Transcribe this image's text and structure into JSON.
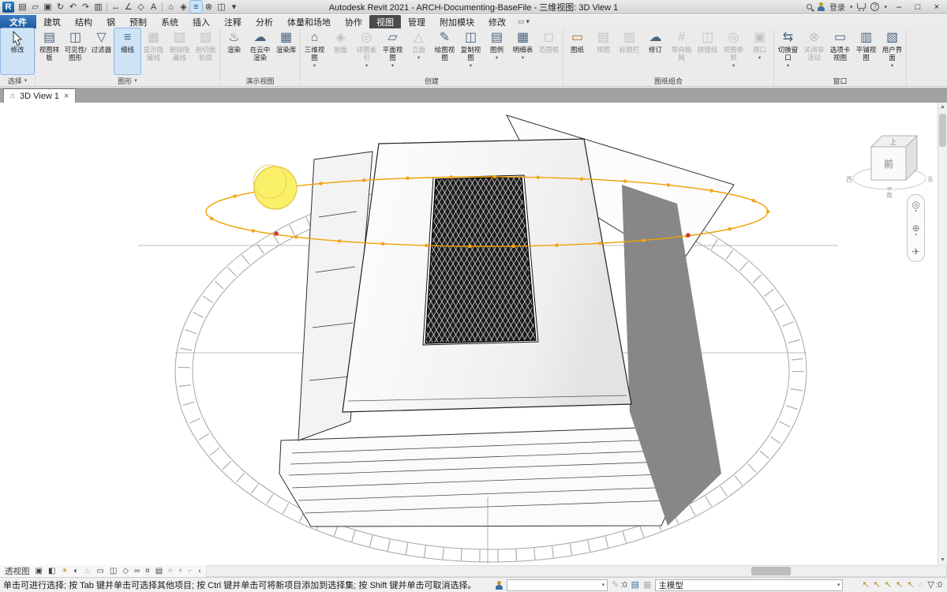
{
  "titlebar": {
    "title": "Autodesk Revit 2021 - ARCH-Documenting-BaseFile - 三维视图: 3D View 1",
    "qat": [
      {
        "name": "revit-logo",
        "glyph": "R"
      },
      {
        "name": "active-document-icon",
        "glyph": "▤"
      },
      {
        "name": "open-icon",
        "glyph": "▱"
      },
      {
        "name": "save-icon",
        "glyph": "▣"
      },
      {
        "name": "sync-with-central-icon",
        "glyph": "↻"
      },
      {
        "name": "undo-icon",
        "glyph": "↶"
      },
      {
        "name": "redo-icon",
        "glyph": "↷"
      },
      {
        "name": "print-icon",
        "glyph": "▥"
      },
      {
        "name": "measure-icon",
        "glyph": "↔"
      },
      {
        "name": "aligned-dimension-icon",
        "glyph": "∠"
      },
      {
        "name": "tag-by-category-icon",
        "glyph": "◇"
      },
      {
        "name": "text-icon",
        "glyph": "A"
      },
      {
        "name": "default-3d-view-icon",
        "glyph": "⌂"
      },
      {
        "name": "section-icon",
        "glyph": "◈"
      },
      {
        "name": "thin-lines-icon",
        "glyph": "≡"
      },
      {
        "name": "close-hidden-windows-icon",
        "glyph": "⊗"
      },
      {
        "name": "switch-windows-icon",
        "glyph": "◫"
      },
      {
        "name": "customize-qat-icon",
        "glyph": "▾"
      }
    ],
    "signin_label": "登录",
    "window": {
      "min": "–",
      "max": "□",
      "close": "×"
    }
  },
  "ui": {
    "caret": "▾",
    "tab_close": "×",
    "house": "⌂",
    "scroll_up": "▲",
    "scroll_down": "▼",
    "collapse": "‹"
  },
  "ribbon": {
    "file_tab": "文件",
    "tabs": [
      "建筑",
      "结构",
      "钢",
      "预制",
      "系统",
      "插入",
      "注释",
      "分析",
      "体量和场地",
      "协作",
      "视图",
      "管理",
      "附加模块",
      "修改"
    ],
    "options_glyph": "▭",
    "panels": [
      {
        "label": "选择",
        "buttons": [
          {
            "label": "修改"
          }
        ]
      },
      {
        "label": "图形",
        "buttons": [
          {
            "label": "视图样板",
            "glyph": "▤"
          },
          {
            "label": "可见性/图形",
            "glyph": "◫"
          },
          {
            "label": "过滤器",
            "glyph": "▽"
          },
          {
            "label": "细线",
            "glyph": "≡"
          },
          {
            "label": "显示隐藏线",
            "glyph": "▦"
          },
          {
            "label": "删除隐藏线",
            "glyph": "▧"
          },
          {
            "label": "剖切面轮廓",
            "glyph": "▨"
          }
        ]
      },
      {
        "label": "演示视图",
        "buttons": [
          {
            "label": "渲染",
            "glyph": "♨"
          },
          {
            "label": "在云中渲染",
            "glyph": "☁"
          },
          {
            "label": "渲染库",
            "glyph": "▦"
          }
        ]
      },
      {
        "label": "创建",
        "buttons": [
          {
            "label": "三维视图",
            "glyph": "⌂"
          },
          {
            "label": "剖面",
            "glyph": "◈"
          },
          {
            "label": "详图索引",
            "glyph": "◎"
          },
          {
            "label": "平面视图",
            "glyph": "▱"
          },
          {
            "label": "立面",
            "glyph": "△"
          },
          {
            "label": "绘图视图",
            "glyph": "✎"
          },
          {
            "label": "复制视图",
            "glyph": "◫"
          },
          {
            "label": "图例",
            "glyph": "▤"
          },
          {
            "label": "明细表",
            "glyph": "▦"
          },
          {
            "label": "范围框",
            "glyph": "◻"
          }
        ]
      },
      {
        "label": "图纸组合",
        "buttons": [
          {
            "label": "图纸",
            "glyph": "▭"
          },
          {
            "label": "视图",
            "glyph": "▤"
          },
          {
            "label": "标题栏",
            "glyph": "▥"
          },
          {
            "label": "修订",
            "glyph": "☁"
          },
          {
            "label": "导向轴网",
            "glyph": "#"
          },
          {
            "label": "拼接线",
            "glyph": "◫"
          },
          {
            "label": "视图参照",
            "glyph": "◎"
          },
          {
            "label": "视口",
            "glyph": "▣"
          }
        ]
      },
      {
        "label": "窗口",
        "buttons": [
          {
            "label": "切换窗口",
            "glyph": "⇆"
          },
          {
            "label": "关闭非活动",
            "glyph": "⊗"
          },
          {
            "label": "选项卡视图",
            "glyph": "▭"
          },
          {
            "label": "平铺视图",
            "glyph": "▥"
          },
          {
            "label": "用户界面",
            "glyph": "▧"
          }
        ]
      }
    ]
  },
  "viewtab": {
    "label": "3D View 1"
  },
  "viewcube": {
    "top": "上",
    "front": "前",
    "south": "南",
    "west": "西",
    "east": "东"
  },
  "navbar": {
    "wheel": "◎",
    "zoom": "⊕",
    "fly": "✈"
  },
  "view_control_bar": {
    "view_type": "透视图",
    "icons": [
      {
        "name": "crop-size-icon",
        "glyph": "▣"
      },
      {
        "name": "visual-style-icon",
        "glyph": "◧"
      },
      {
        "name": "sun-path-icon",
        "glyph": "☀"
      },
      {
        "name": "shadows-icon",
        "glyph": "◐"
      },
      {
        "name": "show-rendering-dialog-icon",
        "glyph": "♨"
      },
      {
        "name": "crop-view-icon",
        "glyph": "▭"
      },
      {
        "name": "show-crop-region-icon",
        "glyph": "◫"
      },
      {
        "name": "locked-3d-view-icon",
        "glyph": "◇"
      },
      {
        "name": "temporary-hide-isolate-icon",
        "glyph": "∞"
      },
      {
        "name": "reveal-hidden-elements-icon",
        "glyph": "¤"
      },
      {
        "name": "temporary-view-properties-icon",
        "glyph": "▤"
      },
      {
        "name": "show-analytical-model-icon",
        "glyph": "≈"
      },
      {
        "name": "highlight-displacement-sets-icon",
        "glyph": "+"
      },
      {
        "name": "reveal-constraints-icon",
        "glyph": "⌐"
      }
    ]
  },
  "statusbar": {
    "hint": "单击可进行选择; 按 Tab 键并单击可选择其他项目; 按 Ctrl 键并单击可将新项目添加到选择集; 按 Shift 键并单击可取消选择。",
    "workset_value": "",
    "editing_requests": ":0",
    "design_option_value": "主模型",
    "filter_count": ":0"
  }
}
